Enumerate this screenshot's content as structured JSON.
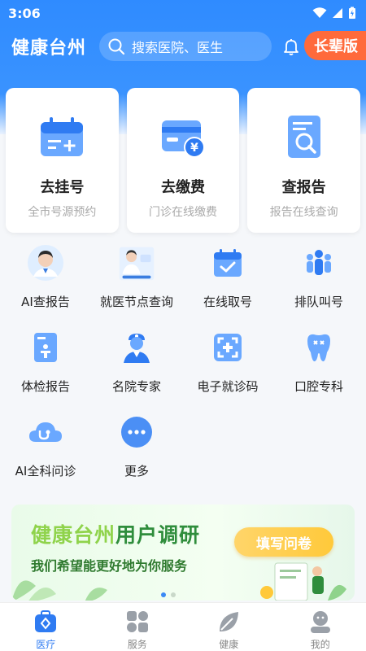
{
  "status_bar": {
    "time": "3:06"
  },
  "header": {
    "app_title": "健康台州",
    "search_placeholder": "搜索医院、医生",
    "elder_mode_label": "长辈版"
  },
  "main_cards": [
    {
      "title": "去挂号",
      "subtitle": "全市号源预约",
      "icon": "calendar-plus-icon"
    },
    {
      "title": "去缴费",
      "subtitle": "门诊在线缴费",
      "icon": "yuan-card-icon"
    },
    {
      "title": "查报告",
      "subtitle": "报告在线查询",
      "icon": "report-search-icon"
    }
  ],
  "services": [
    {
      "label": "AI查报告",
      "icon": "ai-doctor-avatar-icon"
    },
    {
      "label": "就医节点查询",
      "icon": "doctor-poster-icon"
    },
    {
      "label": "在线取号",
      "icon": "calendar-check-icon"
    },
    {
      "label": "排队叫号",
      "icon": "queue-people-icon"
    },
    {
      "label": "体检报告",
      "icon": "checkup-report-icon"
    },
    {
      "label": "名院专家",
      "icon": "doctor-expert-icon"
    },
    {
      "label": "电子就诊码",
      "icon": "scan-code-icon"
    },
    {
      "label": "口腔专科",
      "icon": "tooth-icon"
    },
    {
      "label": "AI全科问诊",
      "icon": "cloud-stethoscope-icon"
    },
    {
      "label": "更多",
      "icon": "more-dots-icon"
    }
  ],
  "banner": {
    "title_part1": "健康台州",
    "title_part2": "用户调研",
    "subtitle": "我们希望能更好地为你服务",
    "button_label": "填写问卷"
  },
  "tabbar": [
    {
      "label": "医疗",
      "icon": "medical-kit-icon",
      "active": true
    },
    {
      "label": "服务",
      "icon": "grid-apps-icon",
      "active": false
    },
    {
      "label": "健康",
      "icon": "leaf-icon",
      "active": false
    },
    {
      "label": "我的",
      "icon": "user-face-icon",
      "active": false
    }
  ],
  "colors": {
    "primary": "#2f8bff",
    "elder_button": "#ff6a3b",
    "banner_green": "#2f8d3c",
    "active_tab": "#2f7bf2"
  }
}
